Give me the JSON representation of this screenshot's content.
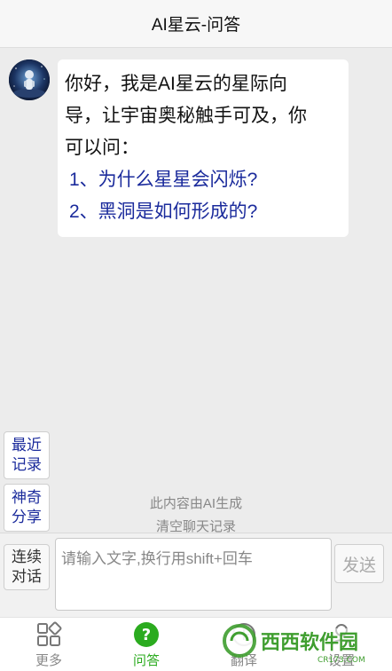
{
  "header": {
    "title": "AI星云-问答"
  },
  "chat": {
    "message_line1": "你好，我是AI星云的星际向",
    "message_line2": "导，让宇宙奥秘触手可及，你",
    "message_line3": "可以问：",
    "suggestions": [
      "1、为什么星星会闪烁?",
      "2、黑洞是如何形成的?"
    ]
  },
  "side": {
    "recent_line1": "最近",
    "recent_line2": "记录",
    "share_line1": "神奇",
    "share_line2": "分享"
  },
  "notice": {
    "ai_generated": "此内容由AI生成",
    "clear_history": "清空聊天记录"
  },
  "input": {
    "continue_line1": "连续",
    "continue_line2": "对话",
    "placeholder": "请输入文字,换行用shift+回车",
    "send_label": "发送"
  },
  "tabs": [
    {
      "label": "更多",
      "icon": "grid-icon"
    },
    {
      "label": "问答",
      "icon": "question-icon"
    },
    {
      "label": "翻译",
      "icon": "translate-icon"
    },
    {
      "label": "设置",
      "icon": "user-settings-icon"
    }
  ],
  "watermark": {
    "text": "西西软件园",
    "sub": "CR173.COM"
  },
  "colors": {
    "accent_green": "#2bab1f",
    "link_blue": "#1b2b9c",
    "background": "#ececec"
  }
}
